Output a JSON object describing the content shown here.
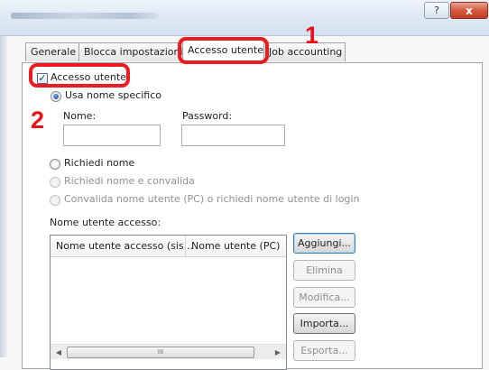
{
  "window": {
    "help_label": "?",
    "close_label": "x"
  },
  "tabs": [
    "Generale",
    "Blocca impostazioni",
    "Accesso utente",
    "Job accounting"
  ],
  "callouts": {
    "tab": "1",
    "checkbox": "2"
  },
  "user_access": {
    "enable_label": "Accesso utente",
    "enable_checked": true,
    "use_specific_label": "Usa nome specifico",
    "name_label": "Nome:",
    "name_value": "",
    "password_label": "Password:",
    "password_value": "",
    "prompt_name_label": "Richiedi nome",
    "prompt_name_validate_label": "Richiedi nome e convalida",
    "validate_pc_label": "Convalida nome utente (PC) o richiedi nome utente di login"
  },
  "login_list": {
    "section_label": "Nome utente accesso:",
    "columns": [
      "Nome utente accesso (sis...",
      "Nome utente (PC)"
    ],
    "rows": [],
    "scroll_thumb": "III"
  },
  "buttons": {
    "add": "Aggiungi...",
    "delete": "Elimina",
    "edit": "Modifica...",
    "import": "Importa...",
    "export": "Esporta..."
  },
  "colors": {
    "callout": "#ec1c24",
    "accent": "#1a4f9c"
  }
}
